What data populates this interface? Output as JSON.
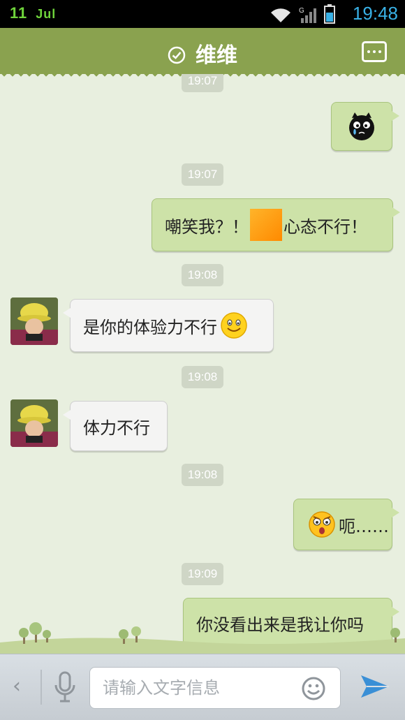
{
  "status_bar": {
    "date": "11",
    "month": "Jul",
    "time": "19:48"
  },
  "header": {
    "title": "维维"
  },
  "messages": [
    {
      "type": "timestamp",
      "text": "19:07"
    },
    {
      "type": "out",
      "sticker": "black-cat-crying-emoji"
    },
    {
      "type": "timestamp",
      "text": "19:07"
    },
    {
      "type": "out",
      "text_before": "嘲笑我？！",
      "text_after": "心态不行！",
      "inline": "orange-square"
    },
    {
      "type": "timestamp",
      "text": "19:08"
    },
    {
      "type": "in",
      "text": "是你的体验力不行",
      "emoji": "smiley-emoji"
    },
    {
      "type": "timestamp",
      "text": "19:08"
    },
    {
      "type": "in",
      "text": "体力不行"
    },
    {
      "type": "timestamp",
      "text": "19:08"
    },
    {
      "type": "out",
      "emoji": "shocked-face-emoji",
      "text": "呃……"
    },
    {
      "type": "timestamp",
      "text": "19:09"
    },
    {
      "type": "out",
      "text": "你没看出来是我让你吗"
    }
  ],
  "input": {
    "placeholder": "请输入文字信息",
    "value": ""
  },
  "colors": {
    "header": "#8aa24f",
    "chat_bg": "#e8efdf",
    "bubble_out": "#cde2a8",
    "bubble_in": "#f4f4f3",
    "send": "#3a8fd6"
  }
}
